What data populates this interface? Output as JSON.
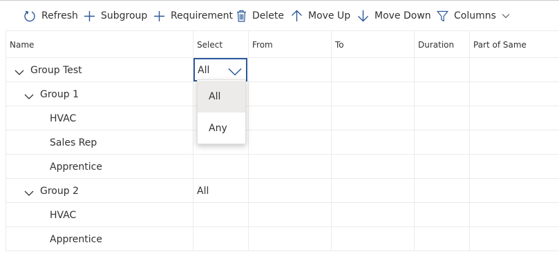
{
  "toolbar": {
    "refresh": "Refresh",
    "subgroup": "Subgroup",
    "requirement": "Requirement",
    "delete": "Delete",
    "move_up": "Move Up",
    "move_down": "Move Down",
    "columns": "Columns"
  },
  "columns": [
    "Name",
    "Select",
    "From",
    "To",
    "Duration",
    "Part of Same"
  ],
  "rows": [
    {
      "name": "Group Test",
      "select": "All"
    },
    {
      "name": "Group 1",
      "select": ""
    },
    {
      "name": "HVAC",
      "select": ""
    },
    {
      "name": "Sales Rep",
      "select": ""
    },
    {
      "name": "Apprentice",
      "select": ""
    },
    {
      "name": "Group 2",
      "select": "All"
    },
    {
      "name": "HVAC",
      "select": ""
    },
    {
      "name": "Apprentice",
      "select": ""
    }
  ],
  "dropdown": {
    "current": "All",
    "options": [
      "All",
      "Any"
    ],
    "highlighted": "All"
  },
  "colors": {
    "accent": "#2b579a",
    "icon": "#2b579a",
    "hover": "#edebe9",
    "border": "#edebe9"
  },
  "icons": [
    "refresh-icon",
    "plus-icon",
    "trash-icon",
    "arrow-up-icon",
    "arrow-down-icon",
    "filter-icon",
    "chevron-down-icon"
  ]
}
